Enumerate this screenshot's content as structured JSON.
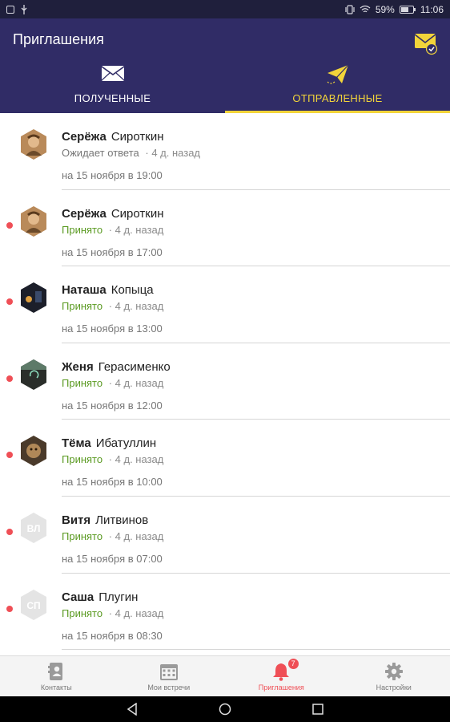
{
  "status_bar": {
    "battery": "59%",
    "time": "11:06"
  },
  "header": {
    "title": "Приглашения",
    "tabs": [
      {
        "label": "ПОЛУЧЕННЫЕ",
        "icon": "envelope-icon",
        "selected": false
      },
      {
        "label": "ОТПРАВЛЕННЫЕ",
        "icon": "paper-plane-icon",
        "selected": true
      }
    ]
  },
  "invitations": [
    {
      "first_name": "Серёжа",
      "last_name": "Сироткин",
      "status": "Ожидает ответа",
      "ago": "· 4 д. назад",
      "date": "на 15 ноября в 19:00",
      "unread": false,
      "avatar": "photo"
    },
    {
      "first_name": "Серёжа",
      "last_name": "Сироткин",
      "status": "Принято",
      "ago": "· 4 д. назад",
      "date": "на 15 ноября в 17:00",
      "unread": true,
      "avatar": "photo"
    },
    {
      "first_name": "Наташа",
      "last_name": "Копыца",
      "status": "Принято",
      "ago": "· 4 д. назад",
      "date": "на 15 ноября в 13:00",
      "unread": true,
      "avatar": "photo"
    },
    {
      "first_name": "Женя",
      "last_name": "Герасименко",
      "status": "Принято",
      "ago": "· 4 д. назад",
      "date": "на 15 ноября в 12:00",
      "unread": true,
      "avatar": "photo"
    },
    {
      "first_name": "Тёма",
      "last_name": "Ибатуллин",
      "status": "Принято",
      "ago": "· 4 д. назад",
      "date": "на 15 ноября в 10:00",
      "unread": true,
      "avatar": "photo"
    },
    {
      "first_name": "Витя",
      "last_name": "Литвинов",
      "status": "Принято",
      "ago": "· 4 д. назад",
      "date": "на 15 ноября в 07:00",
      "unread": true,
      "avatar": "initials",
      "initials": "ВЛ"
    },
    {
      "first_name": "Саша",
      "last_name": "Плугин",
      "status": "Принято",
      "ago": "· 4 д. назад",
      "date": "на 15 ноября в 08:30",
      "unread": true,
      "avatar": "initials",
      "initials": "СП"
    }
  ],
  "bottom_nav": [
    {
      "label": "Контакты",
      "icon": "contacts-icon",
      "active": false
    },
    {
      "label": "Мои встречи",
      "icon": "calendar-icon",
      "active": false
    },
    {
      "label": "Приглашения",
      "icon": "bell-icon",
      "active": true,
      "badge": "7"
    },
    {
      "label": "Настройки",
      "icon": "gear-icon",
      "active": false
    }
  ],
  "colors": {
    "header_bg": "#302c66",
    "accent_yellow": "#f2d43a",
    "accepted_green": "#5a9a21",
    "unread_dot": "#ef4f56",
    "active_nav": "#ef4f56"
  }
}
